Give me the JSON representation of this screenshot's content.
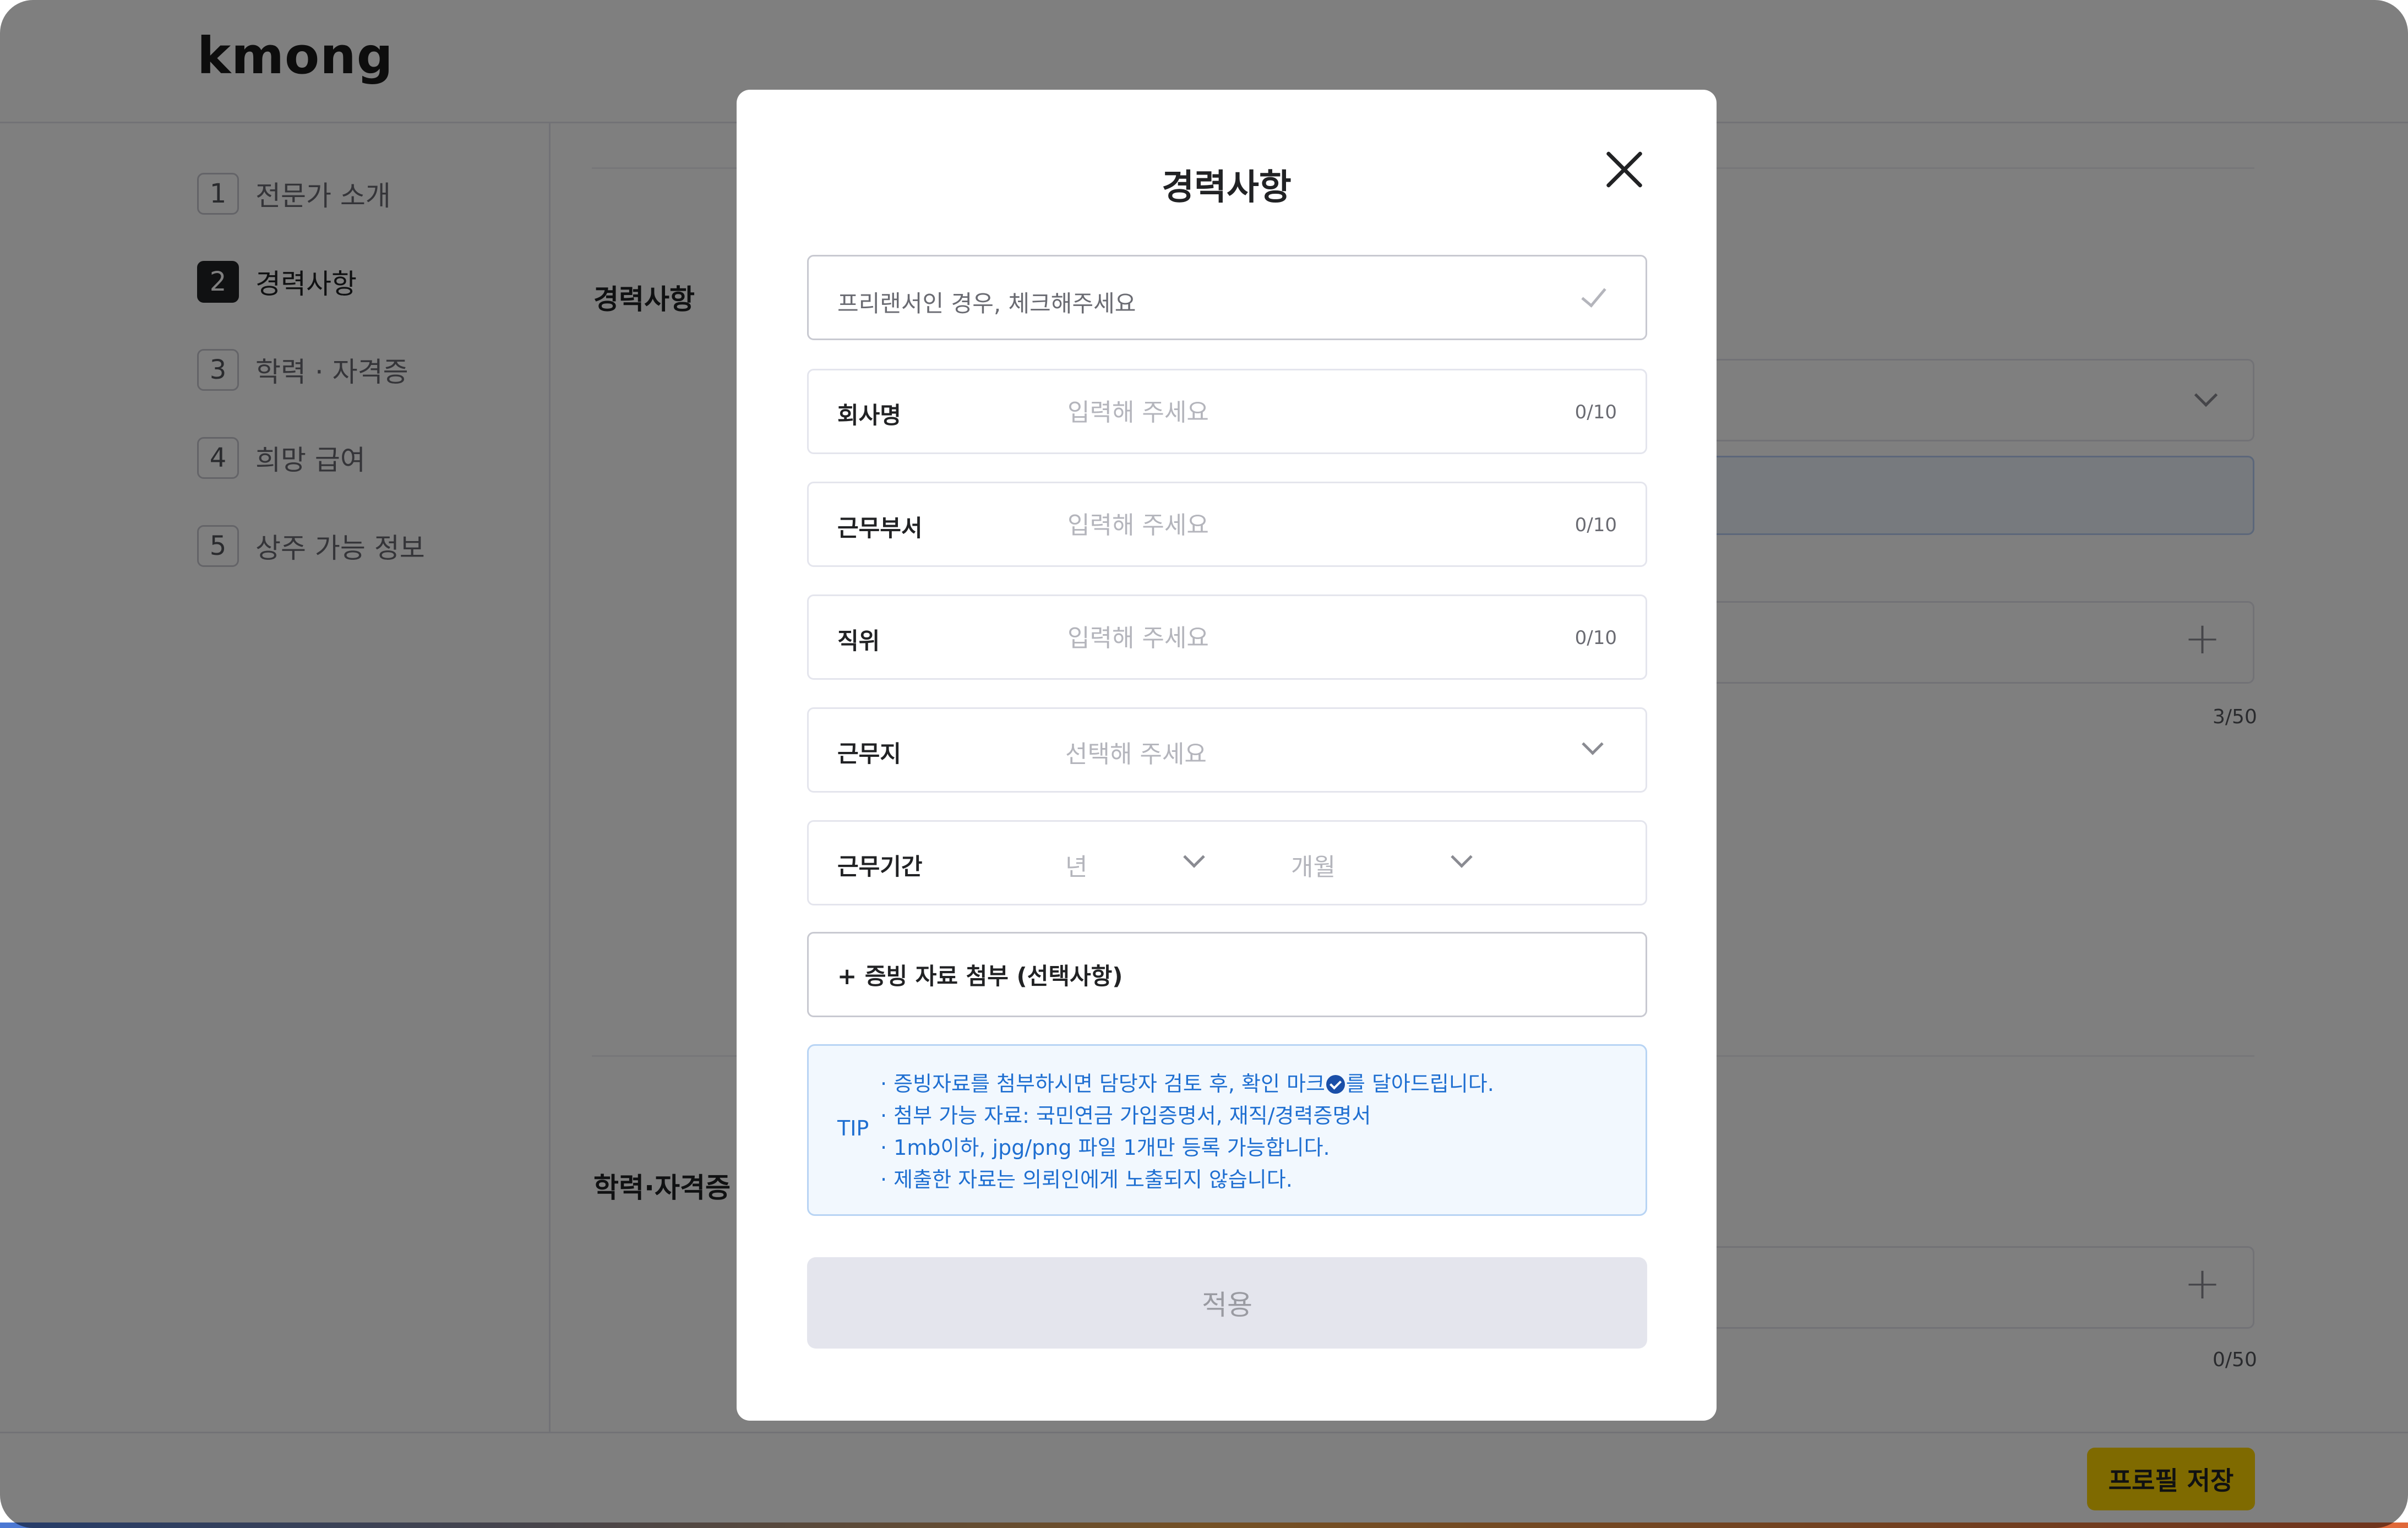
{
  "app": {
    "logo": "kmong"
  },
  "sidebar": {
    "steps": [
      {
        "num": "1",
        "label": "전문가 소개"
      },
      {
        "num": "2",
        "label": "경력사항"
      },
      {
        "num": "3",
        "label": "학력 · 자격증"
      },
      {
        "num": "4",
        "label": "희망 급여"
      },
      {
        "num": "5",
        "label": "상주 가능 정보"
      }
    ],
    "active_step": 2
  },
  "main": {
    "career_title": "경력사항",
    "career_count": "3/50",
    "education_title": "학력·자격증",
    "education_count": "0/50"
  },
  "footer": {
    "save_label": "프로필 저장"
  },
  "modal": {
    "title": "경력사항",
    "freelancer_check": "프리랜서인 경우, 체크해주세요",
    "fields": {
      "company": {
        "label": "회사명",
        "placeholder": "입력해 주세요",
        "count": "0/10"
      },
      "department": {
        "label": "근무부서",
        "placeholder": "입력해 주세요",
        "count": "0/10"
      },
      "position": {
        "label": "직위",
        "placeholder": "입력해 주세요",
        "count": "0/10"
      },
      "location": {
        "label": "근무지",
        "placeholder": "선택해 주세요"
      },
      "period": {
        "label": "근무기간",
        "year_placeholder": "년",
        "month_placeholder": "개월"
      }
    },
    "attach_label": "+ 증빙 자료 첨부 (선택사항)",
    "tip": {
      "label": "TIP",
      "line1_before": "· 증빙자료를 첨부하시면 담당자 검토 후, 확인 마크",
      "line1_after": "를 달아드립니다.",
      "line2": "· 첨부 가능 자료: 국민연금 가입증명서, 재직/경력증명서",
      "line3": "· 1mb이하, jpg/png 파일 1개만 등록 가능합니다.",
      "line4": "· 제출한 자료는 의뢰인에게 노출되지 않습니다."
    },
    "apply_label": "적용"
  }
}
